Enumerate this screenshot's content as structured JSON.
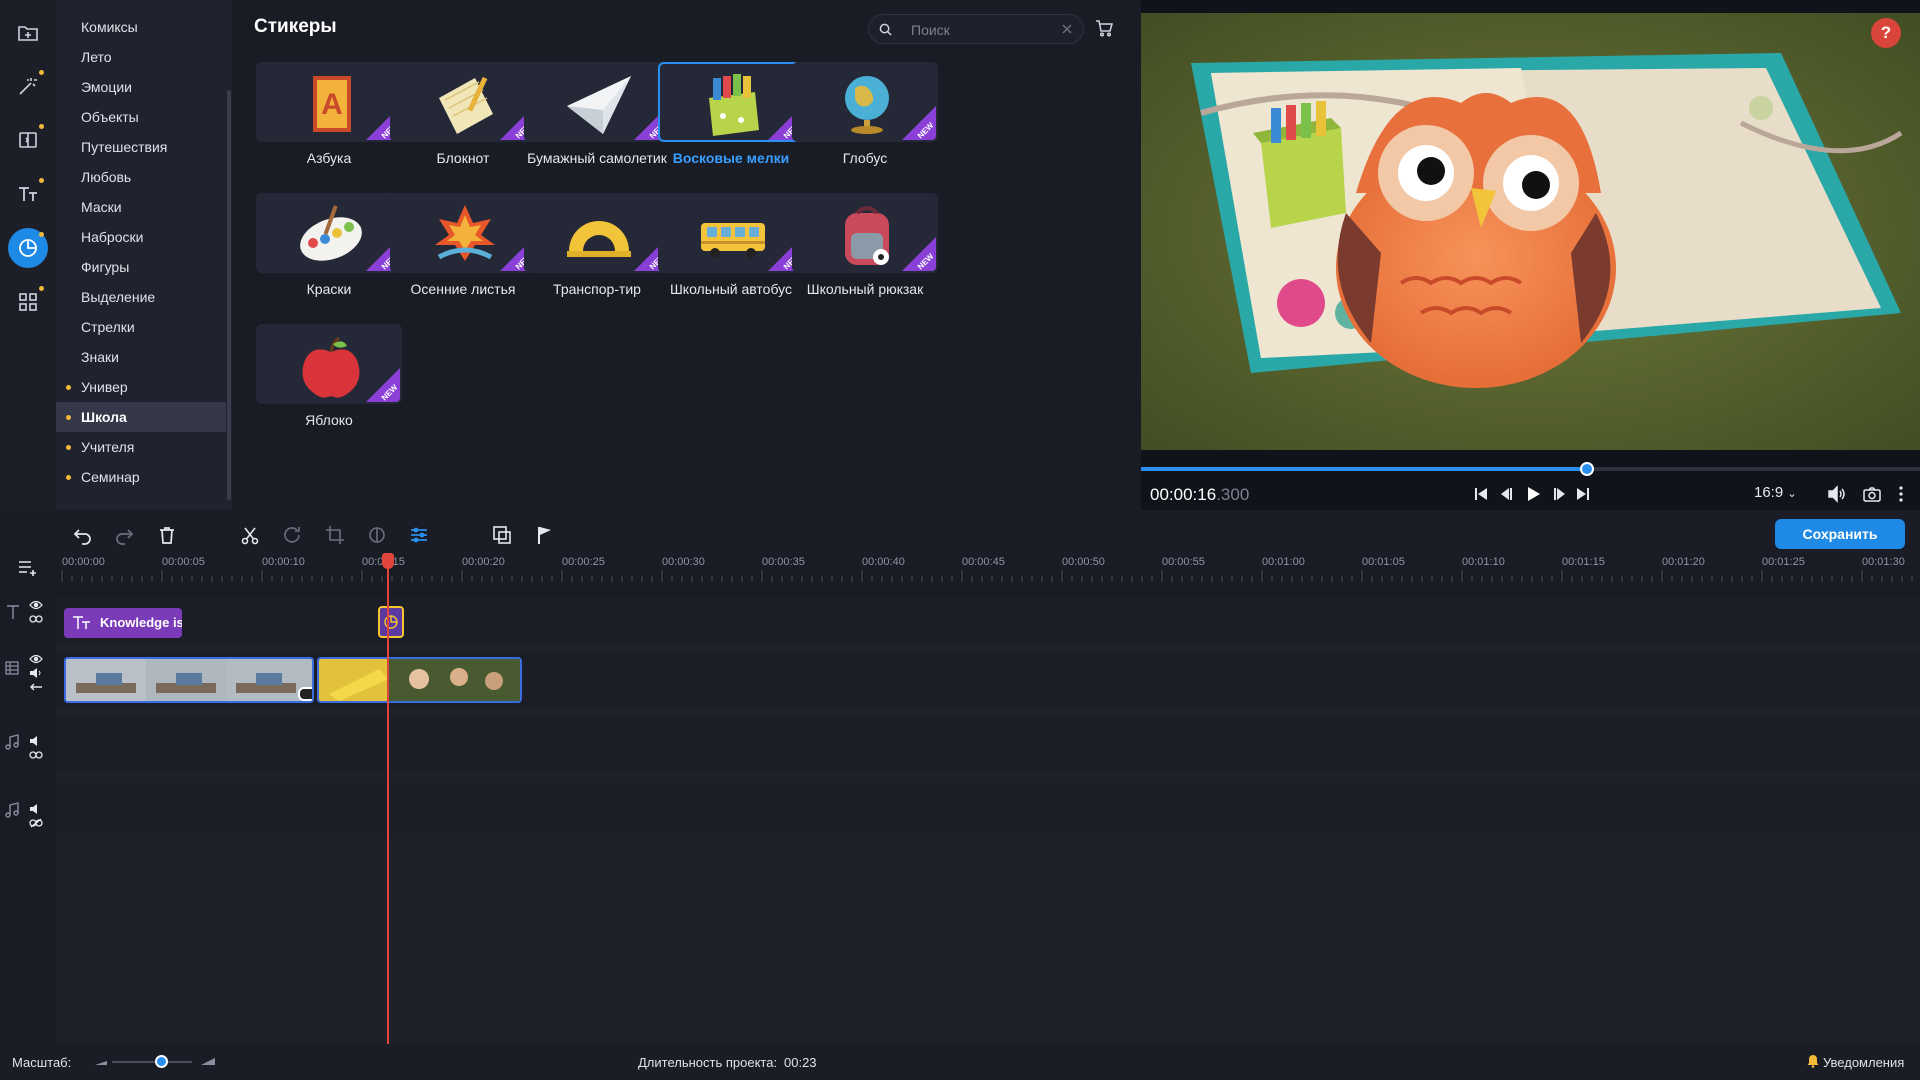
{
  "sidebar": {
    "categories": [
      {
        "label": "Комиксы",
        "dot": false
      },
      {
        "label": "Лето",
        "dot": false
      },
      {
        "label": "Эмоции",
        "dot": false
      },
      {
        "label": "Объекты",
        "dot": false
      },
      {
        "label": "Путешествия",
        "dot": false
      },
      {
        "label": "Любовь",
        "dot": false
      },
      {
        "label": "Маски",
        "dot": false
      },
      {
        "label": "Наброски",
        "dot": false
      },
      {
        "label": "Фигуры",
        "dot": false
      },
      {
        "label": "Выделение",
        "dot": false
      },
      {
        "label": "Стрелки",
        "dot": false
      },
      {
        "label": "Знаки",
        "dot": false
      },
      {
        "label": "Универ",
        "dot": true
      },
      {
        "label": "Школа",
        "dot": true
      },
      {
        "label": "Учителя",
        "dot": true
      },
      {
        "label": "Семинар",
        "dot": true
      }
    ],
    "active_category": "Школа"
  },
  "panel": {
    "title": "Стикеры",
    "search_placeholder": "Поиск",
    "new_badge": "NEW",
    "stickers": [
      {
        "label": "Азбука",
        "icon": "alphabet-book-icon",
        "new": true,
        "selected": false
      },
      {
        "label": "Блокнот",
        "icon": "notepad-icon",
        "new": true,
        "selected": false
      },
      {
        "label": "Бумажный самолетик",
        "icon": "paper-plane-icon",
        "new": true,
        "selected": false
      },
      {
        "label": "Восковые мелки",
        "icon": "crayons-icon",
        "new": true,
        "selected": true
      },
      {
        "label": "Глобус",
        "icon": "globe-icon",
        "new": true,
        "selected": false
      },
      {
        "label": "Краски",
        "icon": "paint-palette-icon",
        "new": true,
        "selected": false
      },
      {
        "label": "Осенние листья",
        "icon": "autumn-leaves-icon",
        "new": true,
        "selected": false
      },
      {
        "label": "Транспор-тир",
        "icon": "protractor-icon",
        "new": true,
        "selected": false
      },
      {
        "label": "Школьный автобус",
        "icon": "school-bus-icon",
        "new": true,
        "selected": false
      },
      {
        "label": "Школьный рюкзак",
        "icon": "school-backpack-icon",
        "new": true,
        "selected": false
      },
      {
        "label": "Яблоко",
        "icon": "apple-icon",
        "new": true,
        "selected": false
      }
    ]
  },
  "preview": {
    "help_label": "?",
    "timecode_main": "00:00:16",
    "timecode_ms": ".300",
    "aspect_ratio": "16:9",
    "progress_fraction": 0.573
  },
  "toolbar": {
    "save_label": "Сохранить"
  },
  "timeline": {
    "ticks": [
      "00:00:00",
      "00:00:05",
      "00:00:10",
      "00:00:15",
      "00:00:20",
      "00:00:25",
      "00:00:30",
      "00:00:35",
      "00:00:40",
      "00:00:45",
      "00:00:50",
      "00:00:55",
      "00:01:00",
      "00:01:05",
      "00:01:10",
      "00:01:15",
      "00:01:20",
      "00:01:25",
      "00:01:30"
    ],
    "title_clip_label": "Knowledge is"
  },
  "statusbar": {
    "zoom_label": "Масштаб:",
    "duration_label": "Длительность проекта:",
    "duration_value": "00:23",
    "notifications_label": "Уведомления"
  },
  "colors": {
    "accent": "#1f8ae6",
    "new_badge": "#8a3fd6",
    "category_dot": "#f5b93a",
    "title_clip": "#7b3ab8",
    "playhead": "#e0443a"
  }
}
